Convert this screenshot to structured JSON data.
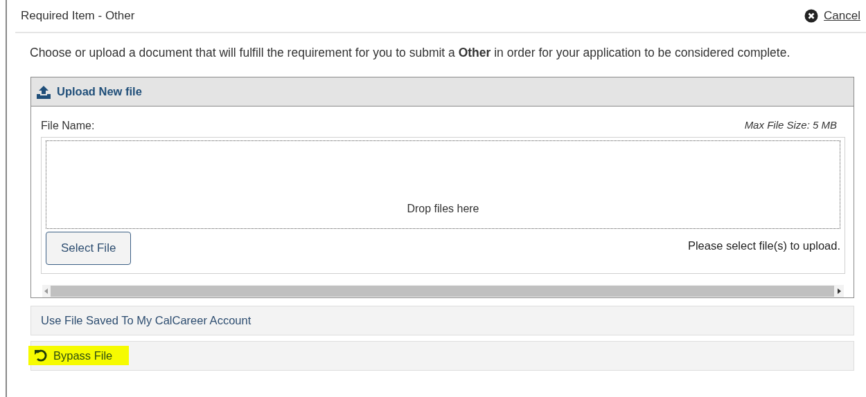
{
  "header": {
    "title": "Required Item - Other",
    "cancel": "Cancel"
  },
  "intro": "Choose or upload a document that will fulfill the requirement for you to submit a **Other** in order for your application to be considered complete.",
  "upload_panel": {
    "title": "Upload New file",
    "file_name_label": "File Name:",
    "max_size": "Max File Size: 5 MB",
    "drop_text": "Drop files here",
    "select_button": "Select File",
    "status": "Please select file(s) to upload."
  },
  "options": [
    {
      "label": "Use File Saved To My CalCareer Account",
      "kind": "plain",
      "highlighted": false
    },
    {
      "label": "Bypass File",
      "kind": "bypass",
      "highlighted": true
    }
  ]
}
